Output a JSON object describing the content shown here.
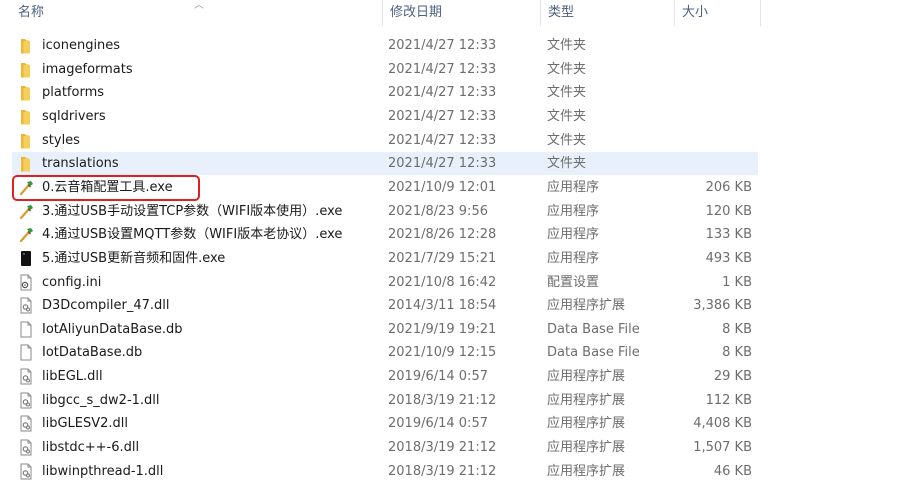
{
  "header": {
    "name": "名称",
    "date": "修改日期",
    "type": "类型",
    "size": "大小"
  },
  "files": [
    {
      "name": "iconengines",
      "date": "2021/4/27 12:33",
      "type": "文件夹",
      "size": "",
      "icon": "folder-icon"
    },
    {
      "name": "imageformats",
      "date": "2021/4/27 12:33",
      "type": "文件夹",
      "size": "",
      "icon": "folder-icon"
    },
    {
      "name": "platforms",
      "date": "2021/4/27 12:33",
      "type": "文件夹",
      "size": "",
      "icon": "folder-icon"
    },
    {
      "name": "sqldrivers",
      "date": "2021/4/27 12:33",
      "type": "文件夹",
      "size": "",
      "icon": "folder-icon"
    },
    {
      "name": "styles",
      "date": "2021/4/27 12:33",
      "type": "文件夹",
      "size": "",
      "icon": "folder-icon"
    },
    {
      "name": "translations",
      "date": "2021/4/27 12:33",
      "type": "文件夹",
      "size": "",
      "icon": "folder-icon"
    },
    {
      "name": "0.云音箱配置工具.exe",
      "date": "2021/10/9 12:01",
      "type": "应用程序",
      "size": "206 KB",
      "icon": "hammer-app-icon"
    },
    {
      "name": "3.通过USB手动设置TCP参数（WIFI版本使用）.exe",
      "date": "2021/8/23 9:56",
      "type": "应用程序",
      "size": "120 KB",
      "icon": "hammer-app-icon"
    },
    {
      "name": "4.通过USB设置MQTT参数（WIFI版本老协议）.exe",
      "date": "2021/8/26 12:28",
      "type": "应用程序",
      "size": "133 KB",
      "icon": "hammer-app-icon"
    },
    {
      "name": "5.通过USB更新音频和固件.exe",
      "date": "2021/7/29 15:21",
      "type": "应用程序",
      "size": "493 KB",
      "icon": "black-app-icon"
    },
    {
      "name": "config.ini",
      "date": "2021/10/8 16:42",
      "type": "配置设置",
      "size": "1 KB",
      "icon": "config-file-icon"
    },
    {
      "name": "D3Dcompiler_47.dll",
      "date": "2014/3/11 18:54",
      "type": "应用程序扩展",
      "size": "3,386 KB",
      "icon": "dll-file-icon"
    },
    {
      "name": "IotAliyunDataBase.db",
      "date": "2021/9/19 19:21",
      "type": "Data Base File",
      "size": "8 KB",
      "icon": "file-icon"
    },
    {
      "name": "IotDataBase.db",
      "date": "2021/10/9 12:15",
      "type": "Data Base File",
      "size": "8 KB",
      "icon": "file-icon"
    },
    {
      "name": "libEGL.dll",
      "date": "2019/6/14 0:57",
      "type": "应用程序扩展",
      "size": "29 KB",
      "icon": "dll-file-icon"
    },
    {
      "name": "libgcc_s_dw2-1.dll",
      "date": "2018/3/19 21:12",
      "type": "应用程序扩展",
      "size": "112 KB",
      "icon": "dll-file-icon"
    },
    {
      "name": "libGLESV2.dll",
      "date": "2019/6/14 0:57",
      "type": "应用程序扩展",
      "size": "4,408 KB",
      "icon": "dll-file-icon"
    },
    {
      "name": "libstdc++-6.dll",
      "date": "2018/3/19 21:12",
      "type": "应用程序扩展",
      "size": "1,507 KB",
      "icon": "dll-file-icon"
    },
    {
      "name": "libwinpthread-1.dll",
      "date": "2018/3/19 21:12",
      "type": "应用程序扩展",
      "size": "46 KB",
      "icon": "dll-file-icon"
    }
  ],
  "selected_index": 5,
  "colors": {
    "selection": "#e8f1fb",
    "highlight_box": "#e02020",
    "folder": "#f3c343"
  }
}
